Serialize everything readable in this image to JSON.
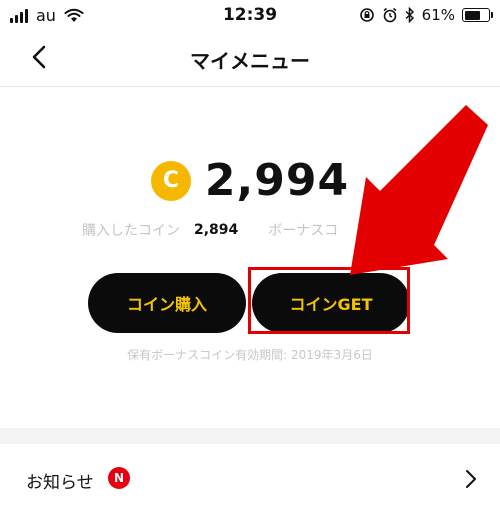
{
  "status_bar": {
    "carrier": "au",
    "time": "12:39",
    "battery": "61%"
  },
  "nav": {
    "title": "マイメニュー"
  },
  "coins": {
    "symbol": "C",
    "total": "2,994",
    "purchased_label": "購入したコイン",
    "purchased_value": "2,894",
    "bonus_label": "ボーナスコ"
  },
  "buttons": {
    "buy": "コイン購入",
    "get": "コインGET"
  },
  "expiry_text": "保有ボーナスコイン有効期間: 2019年3月6日",
  "notice": {
    "label": "お知らせ",
    "badge": "N"
  },
  "colors": {
    "coin": "#f6b700",
    "button_bg": "#0b0b0b",
    "button_text": "#f5c400",
    "highlight": "#e30000",
    "badge": "#e60012"
  }
}
